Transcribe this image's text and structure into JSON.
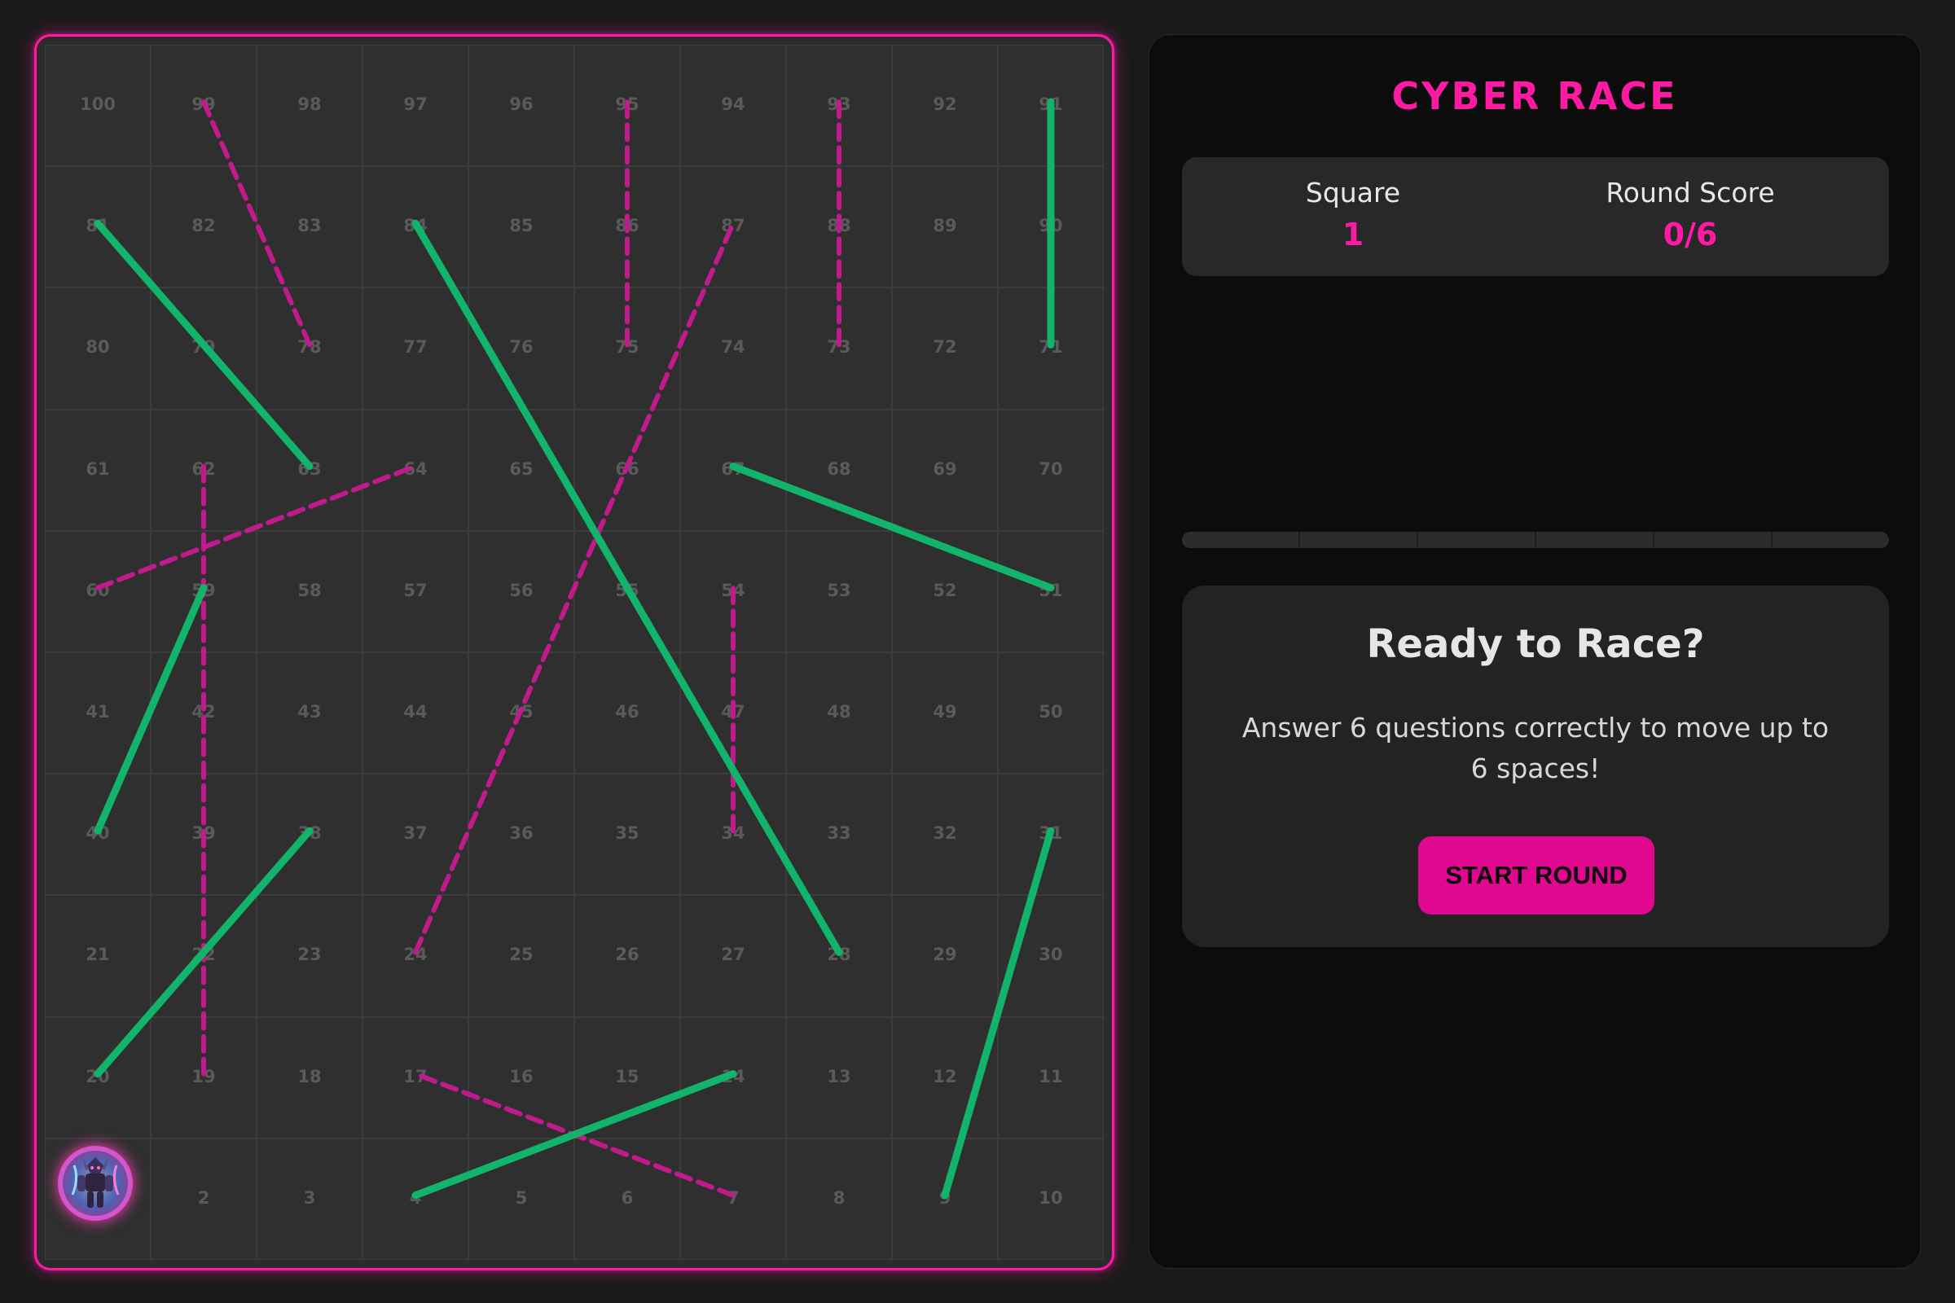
{
  "game": {
    "title": "CYBER RACE"
  },
  "stats": {
    "square_label": "Square",
    "square_value": "1",
    "score_label": "Round Score",
    "score_value": "0/6"
  },
  "round_progress": {
    "answered": 0,
    "total": 6
  },
  "ready_card": {
    "title": "Ready to Race?",
    "description": "Answer 6 questions correctly to move up to 6 spaces!",
    "start_button": "START ROUND"
  },
  "board": {
    "rows": [
      [
        100,
        99,
        98,
        97,
        96,
        95,
        94,
        93,
        92,
        91
      ],
      [
        81,
        82,
        83,
        84,
        85,
        86,
        87,
        88,
        89,
        90
      ],
      [
        80,
        79,
        78,
        77,
        76,
        75,
        74,
        73,
        72,
        71
      ],
      [
        61,
        62,
        63,
        64,
        65,
        66,
        67,
        68,
        69,
        70
      ],
      [
        60,
        59,
        58,
        57,
        56,
        55,
        54,
        53,
        52,
        51
      ],
      [
        41,
        42,
        43,
        44,
        45,
        46,
        47,
        48,
        49,
        50
      ],
      [
        40,
        39,
        38,
        37,
        36,
        35,
        34,
        33,
        32,
        31
      ],
      [
        21,
        22,
        23,
        24,
        25,
        26,
        27,
        28,
        29,
        30
      ],
      [
        20,
        19,
        18,
        17,
        16,
        15,
        14,
        13,
        12,
        11
      ],
      [
        1,
        2,
        3,
        4,
        5,
        6,
        7,
        8,
        9,
        10
      ]
    ],
    "player_square": 1,
    "ladders": [
      [
        4,
        14
      ],
      [
        9,
        31
      ],
      [
        20,
        38
      ],
      [
        28,
        84
      ],
      [
        40,
        59
      ],
      [
        51,
        67
      ],
      [
        63,
        81
      ],
      [
        71,
        91
      ]
    ],
    "chutes": [
      [
        7,
        17
      ],
      [
        19,
        62
      ],
      [
        24,
        87
      ],
      [
        34,
        54
      ],
      [
        60,
        64
      ],
      [
        75,
        95
      ],
      [
        73,
        93
      ],
      [
        78,
        99
      ]
    ],
    "colors": {
      "accent": "#ff1aa3",
      "ladder": "#12b36a",
      "chute": "#c01a8c"
    }
  }
}
